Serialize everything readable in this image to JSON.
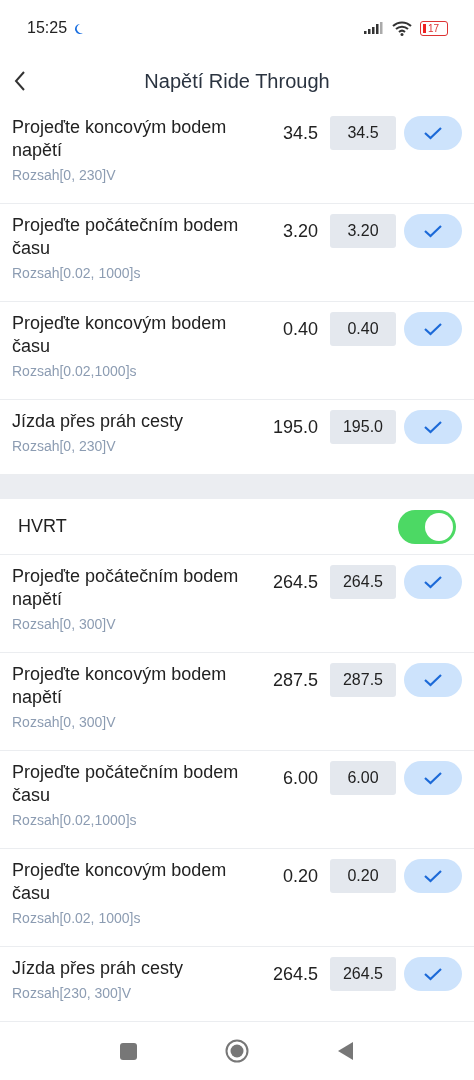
{
  "status_bar": {
    "time": "15:25",
    "battery": "17"
  },
  "header": {
    "title": "Napětí Ride Through"
  },
  "sections": [
    {
      "rows": [
        {
          "label": "Projeďte koncovým bodem napětí",
          "value": "34.5",
          "input": "34.5",
          "range": "Rozsah[0, 230]V"
        },
        {
          "label": "Projeďte počátečním bodem času",
          "value": "3.20",
          "input": "3.20",
          "range": "Rozsah[0.02, 1000]s"
        },
        {
          "label": "Projeďte koncovým bodem času",
          "value": "0.40",
          "input": "0.40",
          "range": "Rozsah[0.02,1000]s"
        },
        {
          "label": "Jízda přes práh cesty",
          "value": "195.0",
          "input": "195.0",
          "range": "Rozsah[0, 230]V"
        }
      ]
    },
    {
      "toggle": {
        "label": "HVRT",
        "on": true
      },
      "rows": [
        {
          "label": "Projeďte počátečním bodem napětí",
          "value": "264.5",
          "input": "264.5",
          "range": "Rozsah[0, 300]V"
        },
        {
          "label": "Projeďte koncovým bodem napětí",
          "value": "287.5",
          "input": "287.5",
          "range": "Rozsah[0, 300]V"
        },
        {
          "label": "Projeďte počátečním bodem času",
          "value": "6.00",
          "input": "6.00",
          "range": "Rozsah[0.02,1000]s"
        },
        {
          "label": "Projeďte koncovým bodem času",
          "value": "0.20",
          "input": "0.20",
          "range": "Rozsah[0.02, 1000]s"
        },
        {
          "label": "Jízda přes práh cesty",
          "value": "264.5",
          "input": "264.5",
          "range": "Rozsah[230, 300]V"
        }
      ]
    }
  ]
}
